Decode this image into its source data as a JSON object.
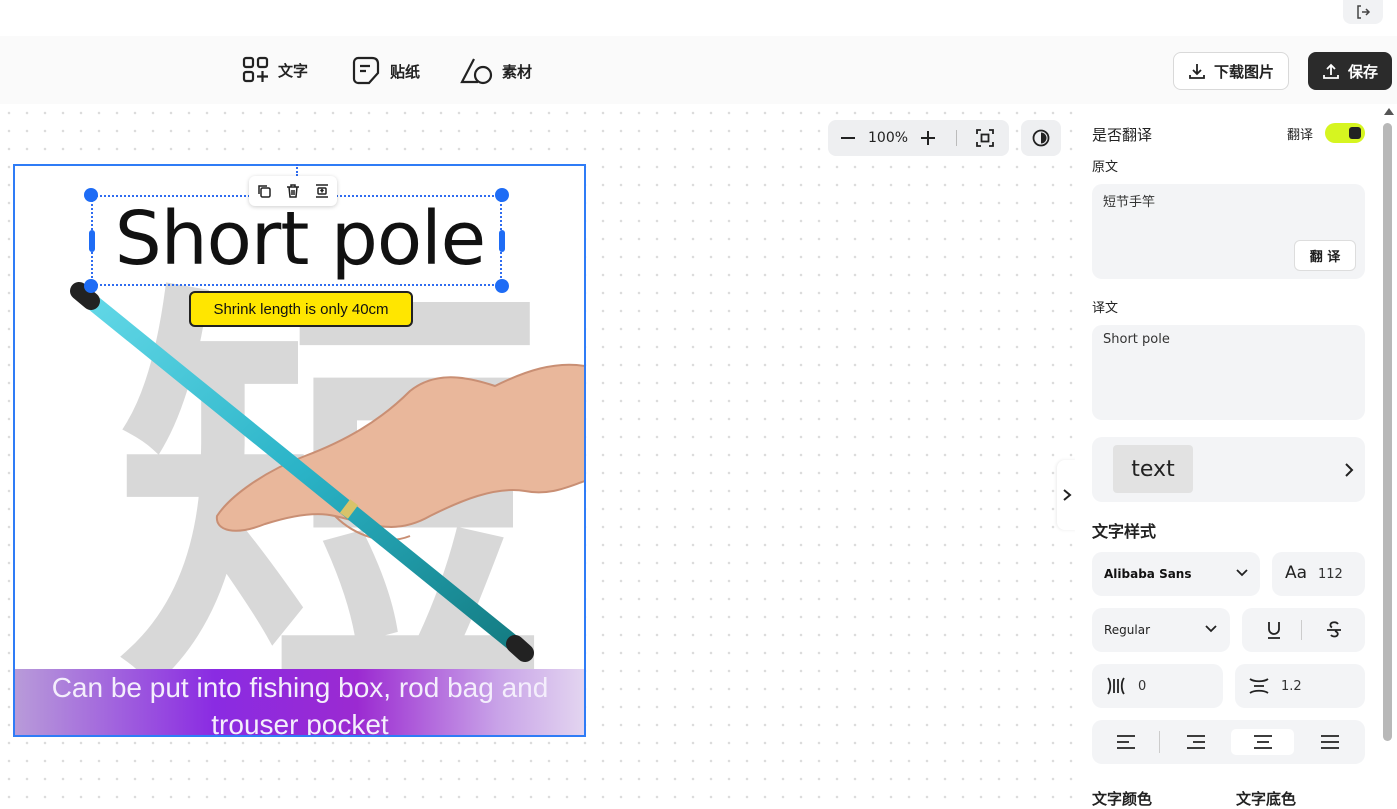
{
  "toolbar": {
    "text_tool": "文字",
    "sticker_tool": "贴纸",
    "material_tool": "素材",
    "download_label": "下载图片",
    "save_label": "保存"
  },
  "zoom": {
    "value": "100%"
  },
  "canvas": {
    "headline": "Short pole",
    "pill_text": "Shrink length is only 40cm",
    "bg_char": "短",
    "footer_text": "Can be put into fishing box, rod bag and trouser pocket"
  },
  "panel": {
    "translate_question": "是否翻译",
    "translate_toggle_label": "翻译",
    "original_label": "原文",
    "original_text": "短节手竿",
    "translate_button": "翻 译",
    "translated_label": "译文",
    "translated_text": "Short pole",
    "preview_text": "text",
    "style_heading": "文字样式",
    "font_family": "Alibaba Sans",
    "font_size": "112",
    "font_weight": "Regular",
    "letter_spacing": "0",
    "line_height": "1.2",
    "text_color_label": "文字颜色",
    "text_bg_label": "文字底色"
  },
  "colors": {
    "accent": "#1e6cf5",
    "toggle": "#d6f520",
    "pill": "#ffe600",
    "dark_button": "#2b2b2b"
  }
}
